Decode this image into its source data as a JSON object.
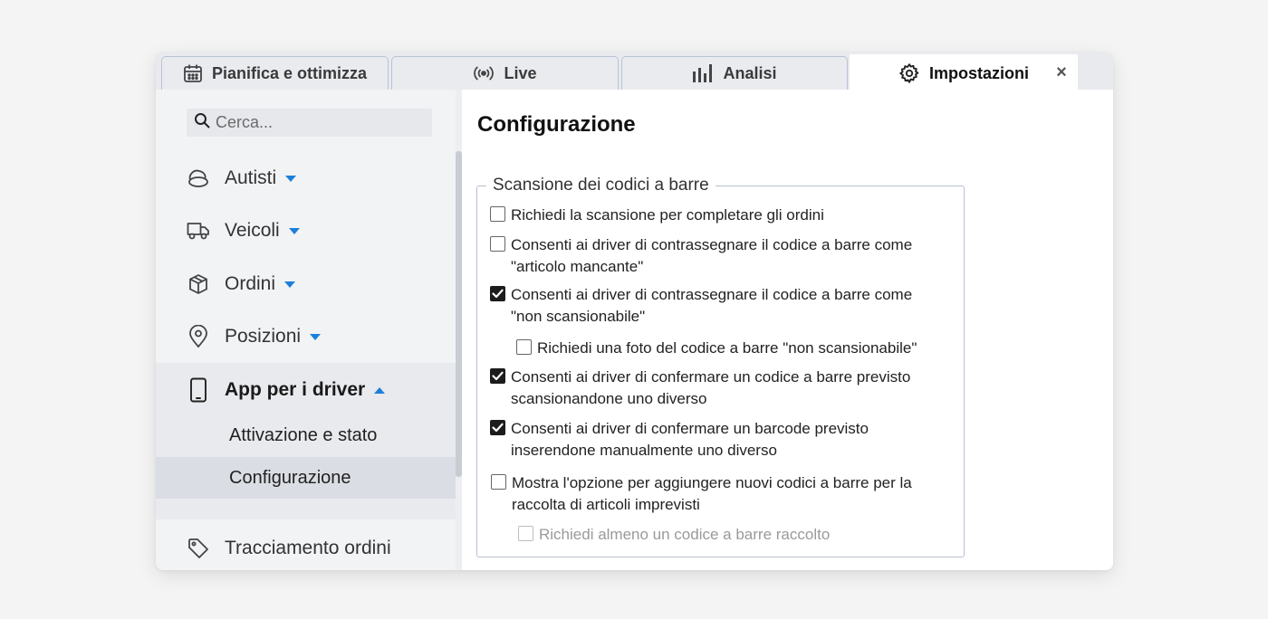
{
  "tabs": [
    {
      "label": "Pianifica e ottimizza",
      "icon": "calendar-icon"
    },
    {
      "label": "Live",
      "icon": "broadcast-icon"
    },
    {
      "label": "Analisi",
      "icon": "bar-chart-icon"
    },
    {
      "label": "Impostazioni",
      "icon": "gear-icon",
      "active": true
    }
  ],
  "close_glyph": "×",
  "sidebar": {
    "search_placeholder": "Cerca...",
    "items": [
      {
        "label": "Autisti",
        "icon": "driver-icon",
        "caret": "down"
      },
      {
        "label": "Veicoli",
        "icon": "truck-icon",
        "caret": "down"
      },
      {
        "label": "Ordini",
        "icon": "box-icon",
        "caret": "down"
      },
      {
        "label": "Posizioni",
        "icon": "location-pin-icon",
        "caret": "down"
      },
      {
        "label": "App per i driver",
        "icon": "smartphone-icon",
        "caret": "up",
        "expanded": true
      },
      {
        "label": "Tracciamento ordini",
        "icon": "tag-icon"
      }
    ],
    "subitems": [
      {
        "label": "Attivazione e stato",
        "selected": false
      },
      {
        "label": "Configurazione",
        "selected": true
      }
    ]
  },
  "content": {
    "title": "Configurazione",
    "group_legend": "Scansione dei codici a barre",
    "options": [
      {
        "text": "Richiedi la scansione per completare gli ordini",
        "checked": false,
        "disabled": false
      },
      {
        "text": "Consenti ai driver di contrassegnare il codice a barre come \"articolo mancante\"",
        "checked": false,
        "disabled": false
      },
      {
        "text": "Consenti ai driver di contrassegnare il codice a barre come \"non scansionabile\"",
        "checked": true,
        "disabled": false
      },
      {
        "text": "Richiedi una foto del codice a barre \"non scansionabile\"",
        "checked": false,
        "disabled": false
      },
      {
        "text": "Consenti ai driver di confermare un codice a barre previsto scansionandone uno diverso",
        "checked": true,
        "disabled": false
      },
      {
        "text": "Consenti ai driver di confermare un barcode previsto inserendone manualmente uno diverso",
        "checked": true,
        "disabled": false
      },
      {
        "text": "Mostra l'opzione per aggiungere nuovi codici a barre per la raccolta di articoli imprevisti",
        "checked": false,
        "disabled": false
      },
      {
        "text": "Richiedi almeno un codice a barre raccolto",
        "checked": false,
        "disabled": true
      }
    ]
  },
  "colors": {
    "accent": "#1e7fd8",
    "checkbox_checked": "#1c1c1c"
  }
}
